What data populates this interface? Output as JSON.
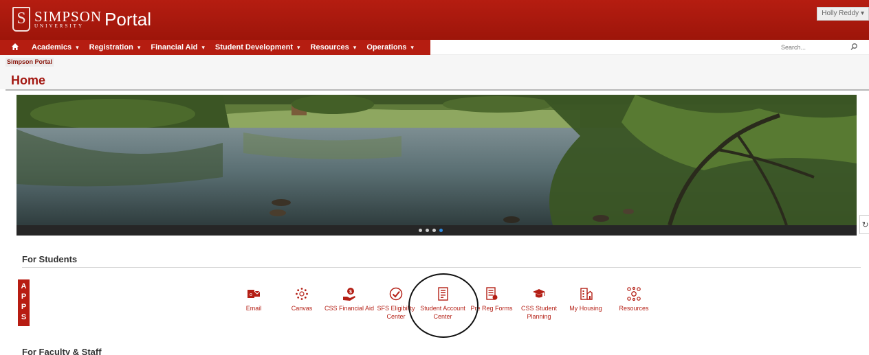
{
  "header": {
    "brand_simpson": "SIMPSON",
    "brand_university": "UNIVERSITY",
    "brand_portal": "Portal",
    "user_name": "Holly Reddy",
    "user_caret": "▾"
  },
  "nav": {
    "items": [
      {
        "label": "Academics",
        "caret": "▾"
      },
      {
        "label": "Registration",
        "caret": "▾"
      },
      {
        "label": "Financial Aid",
        "caret": "▾"
      },
      {
        "label": "Student Development",
        "caret": "▾"
      },
      {
        "label": "Resources",
        "caret": "▾"
      },
      {
        "label": "Operations",
        "caret": "▾"
      }
    ],
    "search_placeholder": "Search..."
  },
  "breadcrumb": "Simpson Portal",
  "page_title": "Home",
  "carousel": {
    "slide_count": 4,
    "active_slide": 4,
    "refresh_glyph": "↻"
  },
  "students": {
    "title": "For Students",
    "apps_letters": [
      "A",
      "P",
      "P",
      "S"
    ],
    "apps": [
      {
        "label": "Email",
        "icon": "outlook-mail-icon"
      },
      {
        "label": "Canvas",
        "icon": "canvas-icon"
      },
      {
        "label": "CSS Financial Aid",
        "icon": "financial-aid-hand-icon"
      },
      {
        "label": "SFS Eligibility Center",
        "icon": "check-circle-icon"
      },
      {
        "label": "Student Account Center",
        "icon": "account-document-icon"
      },
      {
        "label": "Pre Reg Forms",
        "icon": "forms-icon"
      },
      {
        "label": "CSS Student Planning",
        "icon": "graduation-cap-icon"
      },
      {
        "label": "My Housing",
        "icon": "housing-icon"
      },
      {
        "label": "Resources",
        "icon": "resources-network-icon"
      }
    ]
  },
  "faculty": {
    "title": "For Faculty & Staff"
  },
  "colors": {
    "brand_red": "#b51d11",
    "link_red": "#b41f15",
    "active_dot": "#2f8de4"
  }
}
